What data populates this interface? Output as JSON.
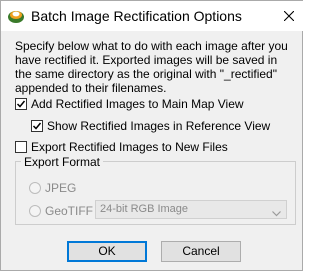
{
  "window": {
    "title": "Batch Image Rectification Options",
    "icon": "app-logo-icon",
    "close_icon": "close-icon"
  },
  "description": "Specify below what to do with each image after you have rectified it. Exported images will be saved in the same directory as the original with \"_rectified\" appended to their filenames.",
  "options": {
    "add_to_main_map": {
      "label": "Add Rectified Images to Main Map View",
      "checked": true
    },
    "show_in_reference": {
      "label": "Show Rectified Images in Reference View",
      "checked": true
    },
    "export_new_files": {
      "label": "Export Rectified Images to New Files",
      "checked": false
    }
  },
  "export_format": {
    "legend": "Export Format",
    "jpeg_label": "JPEG",
    "geotiff_label": "GeoTIFF",
    "selected": "GeoTIFF",
    "color_mode": "24-bit RGB Image",
    "enabled": false
  },
  "buttons": {
    "ok": "OK",
    "cancel": "Cancel"
  },
  "colors": {
    "accent": "#0078d7",
    "disabled_text": "#8a8a8a"
  }
}
